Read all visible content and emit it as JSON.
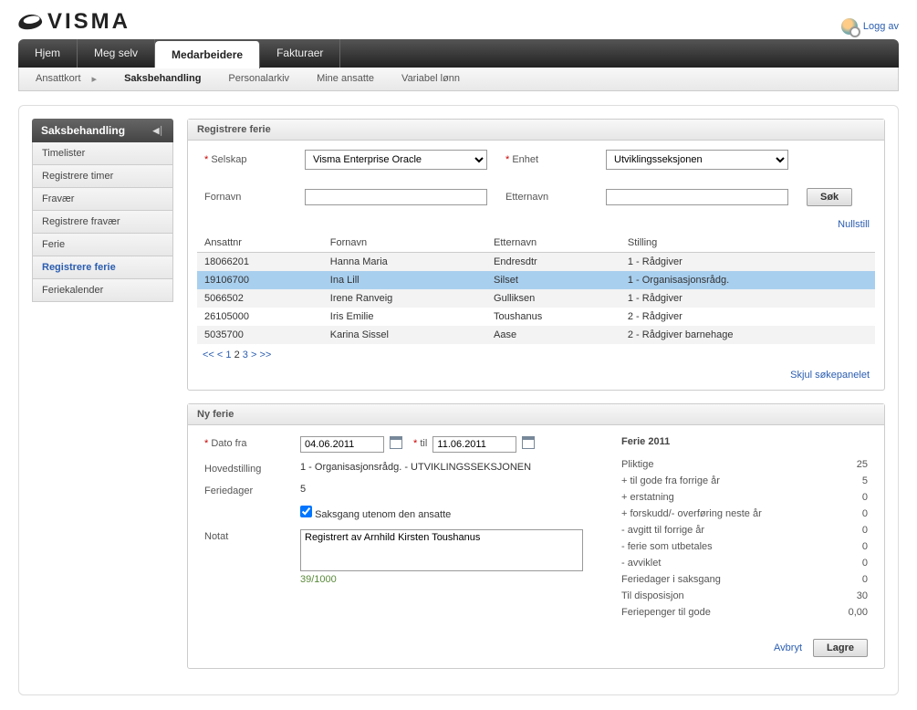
{
  "brand": "VISMA",
  "logout": "Logg av",
  "nav": {
    "main": [
      "Hjem",
      "Meg selv",
      "Medarbeidere",
      "Fakturaer"
    ],
    "active": 2,
    "sub": [
      "Ansattkort",
      "Saksbehandling",
      "Personalarkiv",
      "Mine ansatte",
      "Variabel lønn"
    ],
    "sub_active": 1
  },
  "sidebar": {
    "title": "Saksbehandling",
    "items": [
      "Timelister",
      "Registrere timer",
      "Fravær",
      "Registrere fravær",
      "Ferie",
      "Registrere ferie",
      "Feriekalender"
    ],
    "active": 5
  },
  "search": {
    "title": "Registrere ferie",
    "company_label": "Selskap",
    "company_value": "Visma Enterprise Oracle",
    "unit_label": "Enhet",
    "unit_value": "Utviklingsseksjonen",
    "fname_label": "Fornavn",
    "lname_label": "Etternavn",
    "search_btn": "Søk",
    "reset": "Nullstill",
    "hide": "Skjul søkepanelet",
    "cols": [
      "Ansattnr",
      "Fornavn",
      "Etternavn",
      "Stilling"
    ],
    "rows": [
      {
        "nr": "18066201",
        "fn": "Hanna Maria",
        "en": "Endresdtr",
        "st": "1 - Rådgiver"
      },
      {
        "nr": "19106700",
        "fn": "Ina Lill",
        "en": "Silset",
        "st": "1 - Organisasjonsrådg."
      },
      {
        "nr": "5066502",
        "fn": "Irene Ranveig",
        "en": "Gulliksen",
        "st": "1 - Rådgiver"
      },
      {
        "nr": "26105000",
        "fn": "Iris Emilie",
        "en": "Toushanus",
        "st": "2 - Rådgiver"
      },
      {
        "nr": "5035700",
        "fn": "Karina Sissel",
        "en": "Aase",
        "st": "2 - Rådgiver barnehage"
      }
    ],
    "selected": 1,
    "pager": {
      "first": "<<",
      "prev": "<",
      "pages": [
        "1",
        "2",
        "3"
      ],
      "current": 1,
      "next": ">",
      "last": ">>"
    }
  },
  "ny": {
    "title": "Ny ferie",
    "from_label": "Dato fra",
    "from_value": "04.06.2011",
    "to_label": "til",
    "to_value": "11.06.2011",
    "position_label": "Hovedstilling",
    "position_value": "1 - Organisasjonsrådg. - UTVIKLINGSSEKSJONEN",
    "days_label": "Feriedager",
    "days_value": "5",
    "bypass_label": "Saksgang utenom den ansatte",
    "bypass_checked": true,
    "note_label": "Notat",
    "note_value": "Registrert av Arnhild Kirsten Toushanus",
    "note_count": "39",
    "note_max": "/1000",
    "summary_title": "Ferie 2011",
    "summary": [
      {
        "l": "Pliktige",
        "v": "25"
      },
      {
        "l": "+ til gode fra forrige år",
        "v": "5"
      },
      {
        "l": "+ erstatning",
        "v": "0"
      },
      {
        "l": "+ forskudd/- overføring neste år",
        "v": "0"
      },
      {
        "l": "- avgitt til forrige år",
        "v": "0"
      },
      {
        "l": "- ferie som utbetales",
        "v": "0"
      },
      {
        "l": "- avviklet",
        "v": "0"
      },
      {
        "l": "Feriedager i saksgang",
        "v": "0"
      },
      {
        "l": "Til disposisjon",
        "v": "30"
      },
      {
        "l": "Feriepenger til gode",
        "v": "0,00"
      }
    ],
    "cancel": "Avbryt",
    "save": "Lagre"
  }
}
